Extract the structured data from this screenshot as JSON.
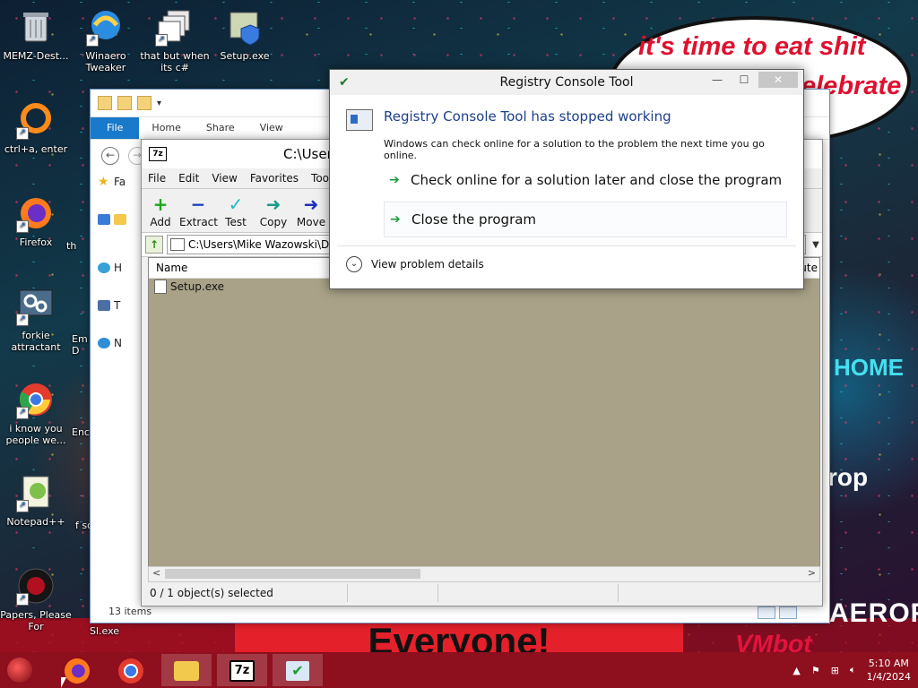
{
  "desktop": {
    "speech_line1": "it's time to eat shit",
    "speech_line2": "elebrate",
    "banner_text": "Everyone!",
    "wallpaper_home": "HOME",
    "wallpaper_aero": "AEROFOS",
    "wallpaper_drop": "rop",
    "wallpaper_watermark": "VMbot",
    "icons": [
      {
        "label": "MEMZ-Dest...",
        "icon": "recycle-bin-icon"
      },
      {
        "label": "Winaero Tweaker",
        "icon": "winaero-icon"
      },
      {
        "label": "that but when its c#",
        "icon": "stacked-windows-icon"
      },
      {
        "label": "Setup.exe",
        "icon": "setup-shield-icon"
      },
      {
        "label": "ctrl+a, enter",
        "icon": "orange-ring-icon"
      },
      {
        "label": "Firefox",
        "icon": "firefox-icon"
      },
      {
        "label": "th",
        "icon": "partial-icon"
      },
      {
        "label": "forkie attractant",
        "icon": "gear-monitor-icon"
      },
      {
        "label": "Em D",
        "icon": "partial-icon"
      },
      {
        "label": "i know you people we...",
        "icon": "chrome-icon"
      },
      {
        "label": "Enc",
        "icon": "partial-icon"
      },
      {
        "label": "Notepad++",
        "icon": "notepadpp-icon"
      },
      {
        "label": "f so",
        "icon": "partial-icon"
      },
      {
        "label": "Papers, Please For",
        "icon": "papers-please-icon"
      },
      {
        "label": "Sl.exe",
        "icon": "partial-icon"
      }
    ]
  },
  "explorer": {
    "tabs": [
      "File",
      "Home",
      "Share",
      "View"
    ],
    "nav_items": [
      "Fa",
      "H",
      "T",
      "N"
    ],
    "status": "13 items"
  },
  "sevenzip": {
    "logo": "7z",
    "title": "C:\\Users\\",
    "menu": [
      "File",
      "Edit",
      "View",
      "Favorites",
      "Tools"
    ],
    "toolbar": [
      {
        "label": "Add",
        "glyph": "+",
        "color": "#1aa81a"
      },
      {
        "label": "Extract",
        "glyph": "−",
        "color": "#1f3fc4"
      },
      {
        "label": "Test",
        "glyph": "✓",
        "color": "#1fb8c8"
      },
      {
        "label": "Copy",
        "glyph": "➜",
        "color": "#1a9a8a"
      },
      {
        "label": "Move",
        "glyph": "➜",
        "color": "#1f2fbf"
      }
    ],
    "address": "C:\\Users\\Mike Wazowski\\Do",
    "column_name": "Name",
    "column_partial": "ute",
    "rows": [
      {
        "name": "Setup.exe"
      }
    ],
    "status_selected": "0 / 1 object(s) selected"
  },
  "dialog": {
    "title": "Registry Console Tool",
    "heading": "Registry Console Tool has stopped working",
    "subtext": "Windows can check online for a solution to the problem the next time you go online.",
    "option1": "Check online for a solution later and close the program",
    "option2": "Close the program",
    "details": "View problem details"
  },
  "taskbar": {
    "items": [
      "Firefox",
      "Google Chrome",
      "File Explorer",
      "7-Zip File Manager",
      "Registry Console Tool"
    ],
    "time": "5:10 AM",
    "date": "1/4/2024"
  },
  "colors": {
    "taskbar": "#8e0f1e",
    "dialog_heading": "#1c3f8f",
    "ribbon_file": "#1979ca",
    "sevenzip_list_bg": "#a9a288"
  }
}
